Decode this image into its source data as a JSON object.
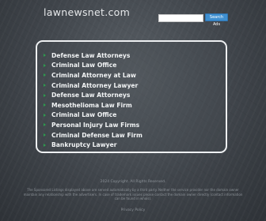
{
  "header": {
    "domain": "lawnewsnet.com",
    "search_placeholder": "",
    "search_button": "Search Ads"
  },
  "links": [
    "Defense Law Attorneys",
    "Criminal Law Office",
    "Criminal Attorney at Law",
    "Criminal Attorney Lawyer",
    "Defense Law Attorneys",
    "Mesothelioma Law Firm",
    "Criminal Law Office",
    "Personal Injury Law Firms",
    "Criminal Defense Law Firm",
    "Bankruptcy Lawyer"
  ],
  "footer": {
    "copyright": "2024 Copyright. All Rights Reserved.",
    "disclaimer": "The Sponsored Listings displayed above are served automatically by a third party. Neither the service provider nor the domain owner maintain any relationship with the advertisers. In case of trademark issues please contact the domain owner directly (contact information can be found in whois).",
    "privacy": "Privacy Policy"
  },
  "colors": {
    "bullet": "#2e9b4e",
    "search_button": "#3f8fd0"
  }
}
